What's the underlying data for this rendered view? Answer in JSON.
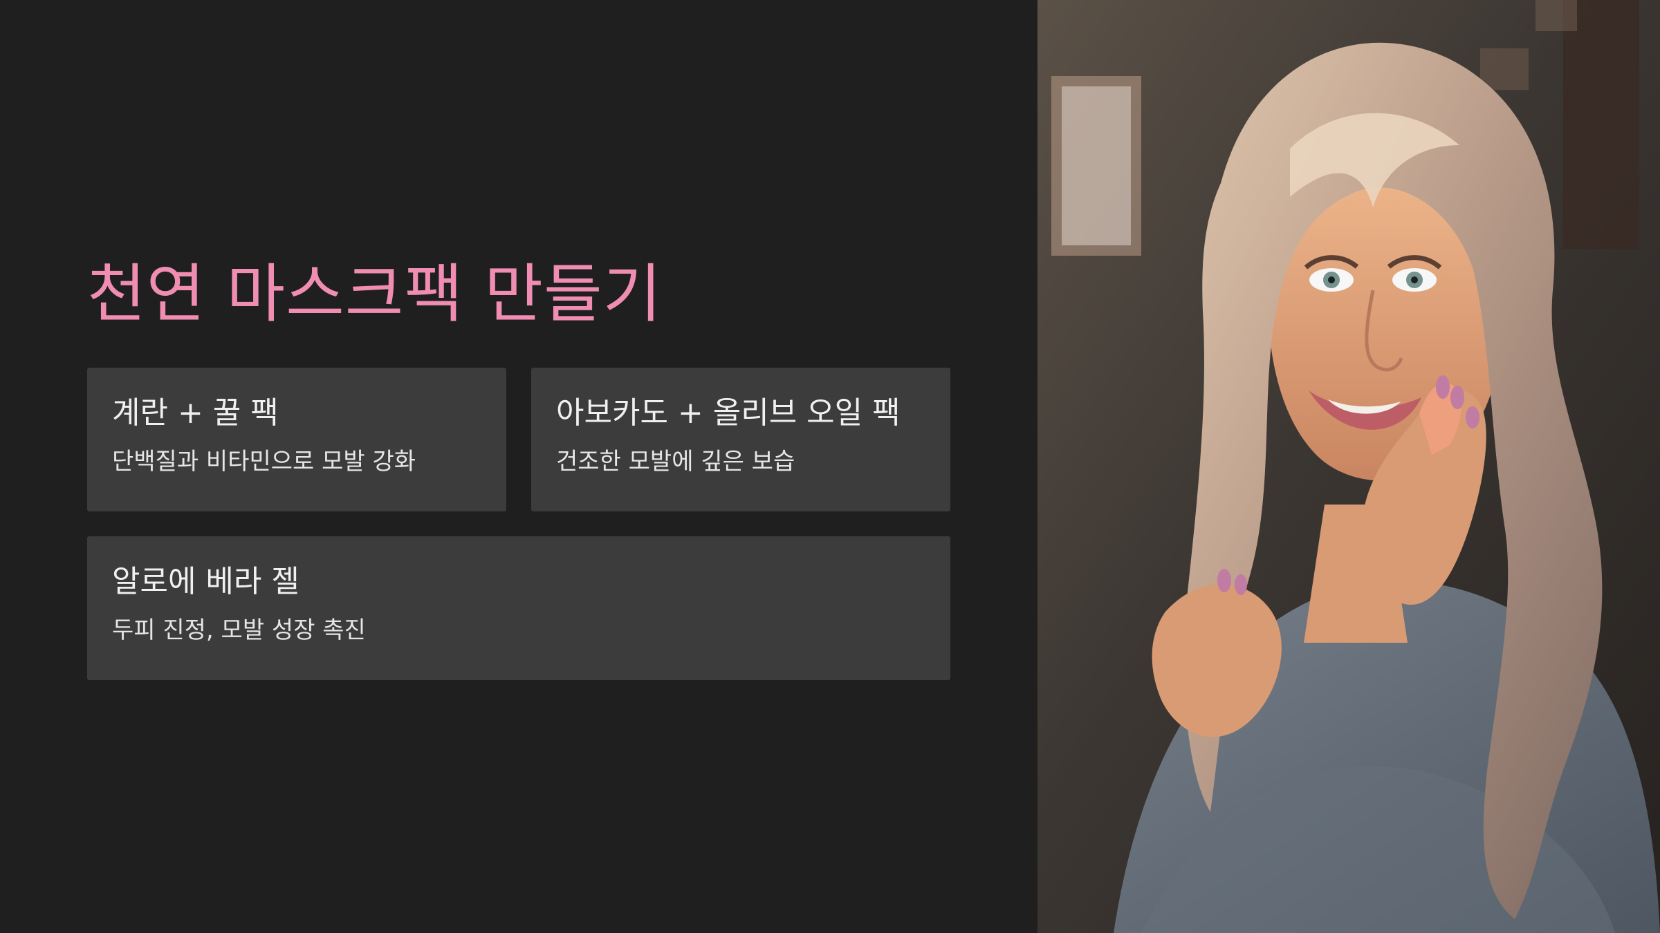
{
  "slide": {
    "title": "천연 마스크팩 만들기",
    "cards": [
      {
        "title": "계란 + 꿀 팩",
        "description": "단백질과 비타민으로 모발 강화"
      },
      {
        "title": "아보카도 + 올리브 오일 팩",
        "description": "건조한 모발에 깊은 보습"
      },
      {
        "title": "알로에 베라 젤",
        "description": "두피 진정, 모발 성장 촉진"
      }
    ]
  },
  "colors": {
    "background": "#1e1e1e",
    "accent": "#f08db2",
    "card": "#3c3c3c",
    "text": "#f0f0f0"
  }
}
